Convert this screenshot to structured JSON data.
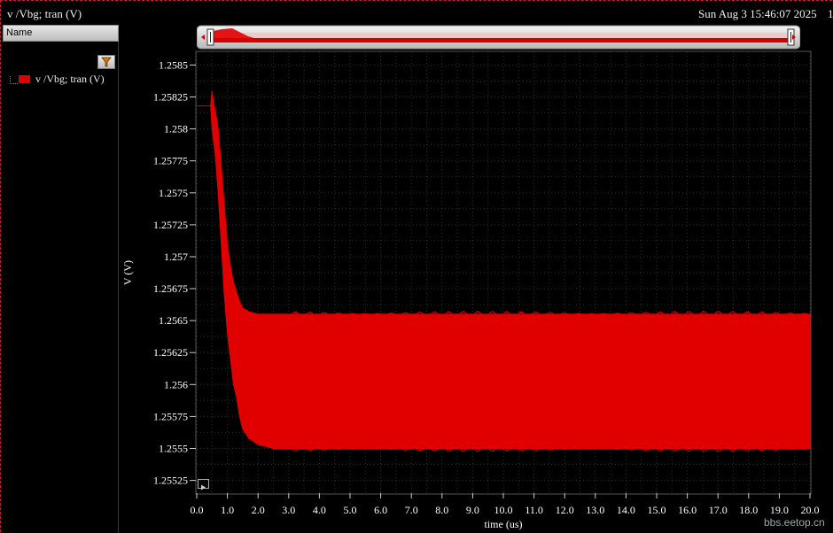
{
  "window": {
    "title": "v /Vbg; tran (V)",
    "date": "Sun Aug 3 15:46:07 2025",
    "index": "1"
  },
  "legend": {
    "header": "Name",
    "trace_label": "v /Vbg; tran (V)",
    "trace_color": "#e00000",
    "filter_icon": "filter-icon"
  },
  "watermark": "bbs.eetop.cn",
  "chart_data": {
    "type": "line",
    "xlabel": "time (us)",
    "ylabel": "V (V)",
    "xlim": [
      0.0,
      20.0
    ],
    "ylim": [
      1.25515,
      1.2586
    ],
    "x_ticks": [
      "0.0",
      "1.0",
      "2.0",
      "3.0",
      "4.0",
      "5.0",
      "6.0",
      "7.0",
      "8.0",
      "9.0",
      "10.0",
      "11.0",
      "12.0",
      "13.0",
      "14.0",
      "15.0",
      "16.0",
      "17.0",
      "18.0",
      "19.0",
      "20.0"
    ],
    "y_ticks": [
      "1.25525",
      "1.2555",
      "1.25575",
      "1.256",
      "1.25625",
      "1.2565",
      "1.25675",
      "1.257",
      "1.25725",
      "1.2575",
      "1.25775",
      "1.258",
      "1.25825",
      "1.2585"
    ],
    "grid": true,
    "series": [
      {
        "name": "v /Vbg; tran (V)",
        "color": "#e00000",
        "x": [
          0.0,
          0.45,
          0.5,
          0.55,
          0.6,
          0.7,
          0.8,
          0.9,
          1.0,
          1.1,
          1.2,
          1.3,
          1.4,
          1.5,
          1.7,
          2.0,
          2.5,
          3.0,
          20.0
        ],
        "upper": [
          1.25818,
          1.25818,
          1.2583,
          1.2582,
          1.25815,
          1.258,
          1.2577,
          1.2574,
          1.2571,
          1.25692,
          1.2568,
          1.25672,
          1.25665,
          1.2566,
          1.25657,
          1.25655,
          1.25655,
          1.25655,
          1.25655
        ],
        "lower": [
          1.25818,
          1.25818,
          1.258,
          1.2579,
          1.2578,
          1.2575,
          1.2571,
          1.2567,
          1.2564,
          1.2562,
          1.256,
          1.2559,
          1.25575,
          1.25565,
          1.25558,
          1.25553,
          1.2555,
          1.2555,
          1.2555
        ]
      }
    ]
  }
}
